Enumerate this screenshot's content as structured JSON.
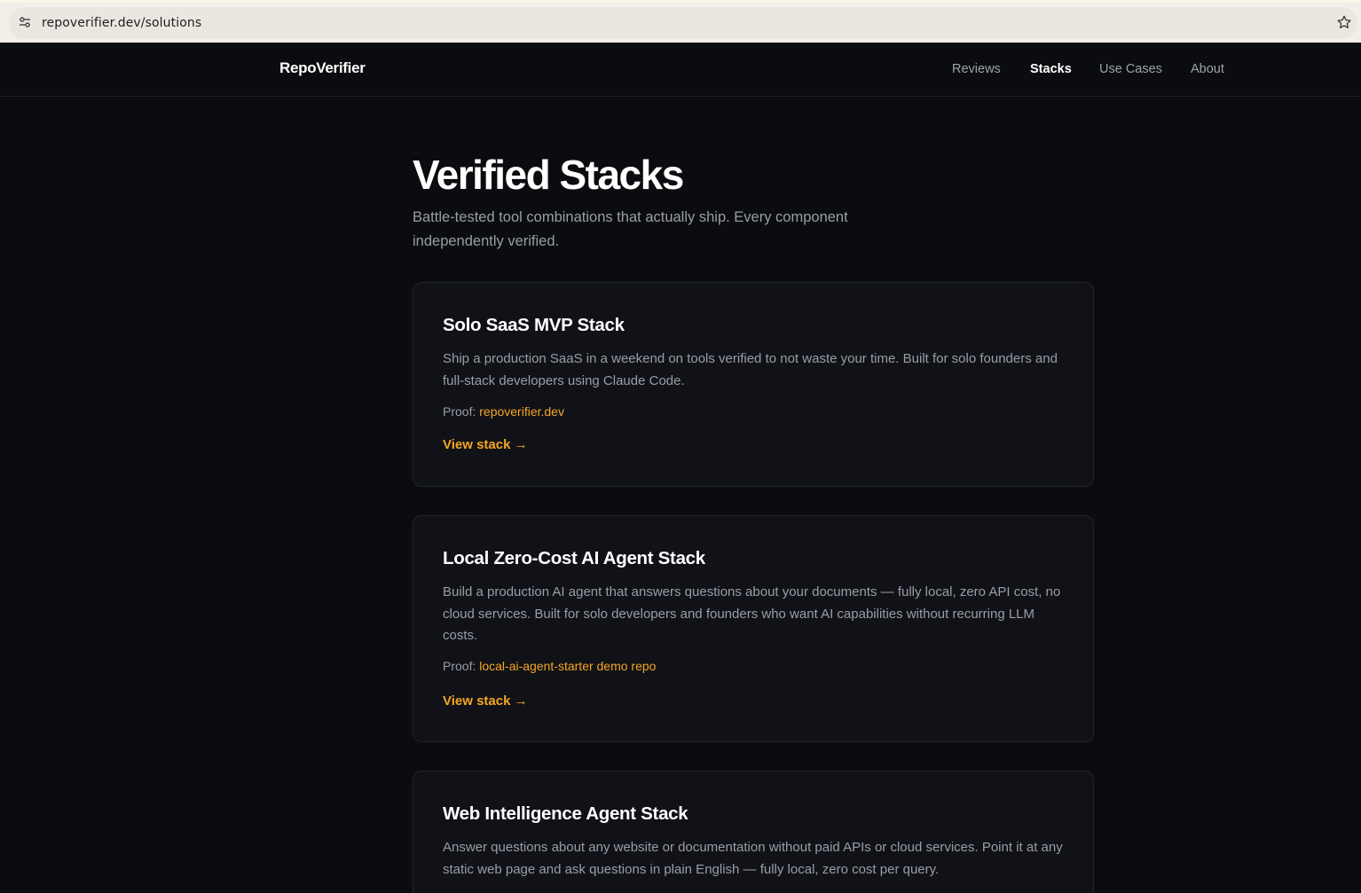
{
  "browser": {
    "url": "repoverifier.dev/solutions"
  },
  "nav": {
    "brand": "RepoVerifier",
    "links": [
      {
        "label": "Reviews",
        "active": false
      },
      {
        "label": "Stacks",
        "active": true
      },
      {
        "label": "Use Cases",
        "active": false
      },
      {
        "label": "About",
        "active": false
      }
    ]
  },
  "hero": {
    "title": "Verified Stacks",
    "subtitle": "Battle-tested tool combinations that actually ship. Every component independently verified."
  },
  "stacks": [
    {
      "title": "Solo SaaS MVP Stack",
      "description": "Ship a production SaaS in a weekend on tools verified to not waste your time. Built for solo founders and full-stack developers using Claude Code.",
      "proof_label": "Proof: ",
      "proof_link": "repoverifier.dev",
      "cta": "View stack →"
    },
    {
      "title": "Local Zero-Cost AI Agent Stack",
      "description": "Build a production AI agent that answers questions about your documents — fully local, zero API cost, no cloud services. Built for solo developers and founders who want AI capabilities without recurring LLM costs.",
      "proof_label": "Proof: ",
      "proof_link": "local-ai-agent-starter demo repo",
      "cta": "View stack →"
    },
    {
      "title": "Web Intelligence Agent Stack",
      "description": "Answer questions about any website or documentation without paid APIs or cloud services. Point it at any static web page and ask questions in plain English — fully local, zero cost per query."
    }
  ],
  "colors": {
    "accent": "#f5a524",
    "background": "#0b0c10",
    "card": "#111217"
  },
  "icons": {
    "site_settings": "tune-icon",
    "bookmark": "star-icon"
  }
}
